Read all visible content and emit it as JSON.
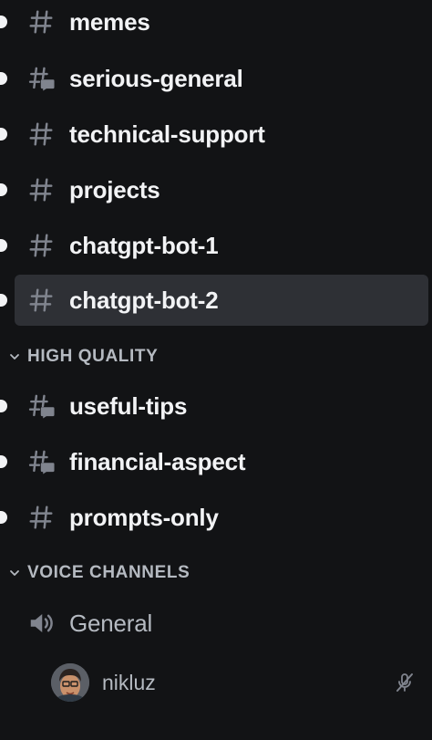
{
  "text_channels": [
    {
      "name": "memes",
      "icon": "hash-icon",
      "unread": true
    },
    {
      "name": "serious-general",
      "icon": "hash-thread-icon",
      "unread": true
    },
    {
      "name": "technical-support",
      "icon": "hash-icon",
      "unread": true
    },
    {
      "name": "projects",
      "icon": "hash-icon",
      "unread": true
    },
    {
      "name": "chatgpt-bot-1",
      "icon": "hash-icon",
      "unread": true
    },
    {
      "name": "chatgpt-bot-2",
      "icon": "hash-icon",
      "unread": true,
      "selected": true
    }
  ],
  "categories": [
    {
      "name": "HIGH QUALITY",
      "expanded": true
    },
    {
      "name": "VOICE CHANNELS",
      "expanded": true
    }
  ],
  "high_quality_channels": [
    {
      "name": "useful-tips",
      "icon": "hash-thread-icon",
      "unread": true
    },
    {
      "name": "financial-aspect",
      "icon": "hash-thread-icon",
      "unread": true
    },
    {
      "name": "prompts-only",
      "icon": "hash-icon",
      "unread": true
    }
  ],
  "voice_channel": {
    "name": "General",
    "icon": "speaker-icon"
  },
  "voice_user": {
    "name": "nikluz",
    "status_icon": "muted-mic-icon"
  },
  "colors": {
    "background": "#121315",
    "selected_row": "#2e3035",
    "text_primary": "#f2f3f5",
    "text_muted": "#b5bac1",
    "icon_muted": "#80848e"
  }
}
